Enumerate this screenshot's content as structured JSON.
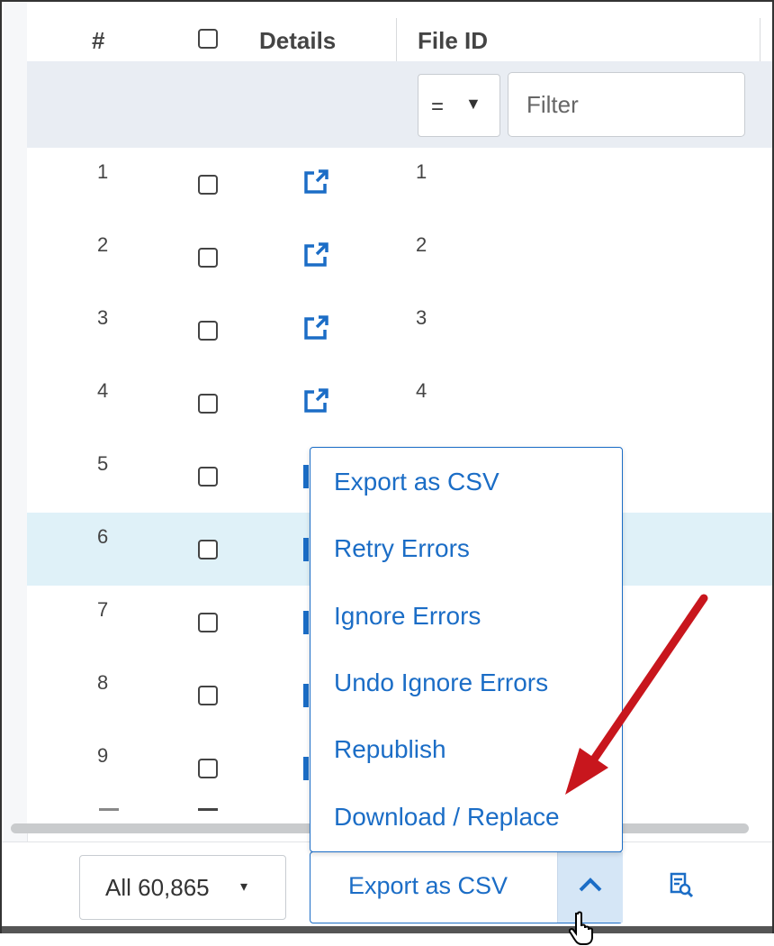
{
  "header": {
    "num": "#",
    "details": "Details",
    "file_id": "File ID"
  },
  "filter": {
    "operator": "=",
    "dropdown_arrow": "▼",
    "placeholder": "Filter"
  },
  "rows": [
    {
      "num": "1",
      "file_id": "1"
    },
    {
      "num": "2",
      "file_id": "2"
    },
    {
      "num": "3",
      "file_id": "3"
    },
    {
      "num": "4",
      "file_id": "4"
    },
    {
      "num": "5",
      "file_id": ""
    },
    {
      "num": "6",
      "file_id": ""
    },
    {
      "num": "7",
      "file_id": ""
    },
    {
      "num": "8",
      "file_id": ""
    },
    {
      "num": "9",
      "file_id": ""
    }
  ],
  "selected_row": "6",
  "menu": {
    "items": [
      "Export as CSV",
      "Retry Errors",
      "Ignore Errors",
      "Undo Ignore Errors",
      "Republish",
      "Download / Replace"
    ]
  },
  "footer": {
    "count_label": "All 60,865",
    "count_caret": "▾",
    "export_label": "Export as CSV",
    "toggle_icon": "chevron-up-icon",
    "report_icon": "report-search-icon"
  },
  "colors": {
    "accent": "#1b6dc6",
    "selected_row": "#dff1f8",
    "arrow": "#c8161d"
  }
}
